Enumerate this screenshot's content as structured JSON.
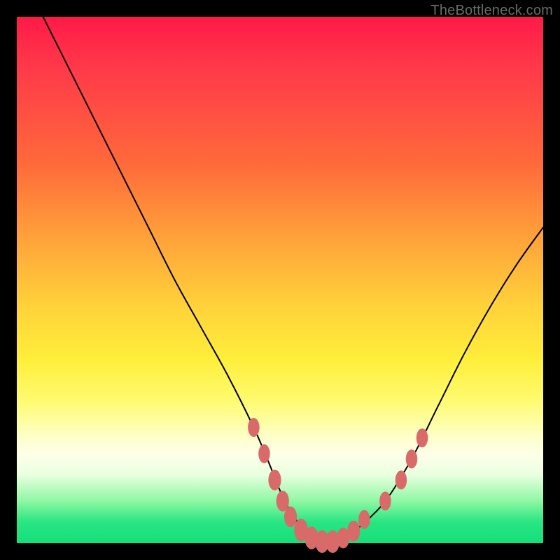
{
  "watermark": "TheBottleneck.com",
  "chart_data": {
    "type": "line",
    "title": "",
    "xlabel": "",
    "ylabel": "",
    "xlim": [
      0,
      100
    ],
    "ylim": [
      0,
      100
    ],
    "series": [
      {
        "name": "curve",
        "x": [
          5,
          10,
          15,
          20,
          25,
          30,
          35,
          40,
          45,
          48,
          50,
          52,
          55,
          58,
          60,
          62,
          65,
          70,
          75,
          80,
          85,
          90,
          95,
          100
        ],
        "values": [
          100,
          90,
          80,
          70,
          60,
          50,
          41,
          32,
          22,
          15,
          10,
          6,
          2,
          0,
          0,
          1,
          3,
          8,
          16,
          26,
          36,
          45,
          53,
          60
        ]
      }
    ],
    "markers": {
      "name": "beads",
      "color": "#d96a6a",
      "points": [
        {
          "x": 45,
          "y": 22,
          "r": 2.0
        },
        {
          "x": 47,
          "y": 17,
          "r": 2.0
        },
        {
          "x": 49,
          "y": 12,
          "r": 2.2
        },
        {
          "x": 50.5,
          "y": 8,
          "r": 2.2
        },
        {
          "x": 52,
          "y": 5,
          "r": 2.2
        },
        {
          "x": 54,
          "y": 2.5,
          "r": 2.4
        },
        {
          "x": 56,
          "y": 1,
          "r": 2.4
        },
        {
          "x": 58,
          "y": 0.3,
          "r": 2.4
        },
        {
          "x": 60,
          "y": 0.3,
          "r": 2.4
        },
        {
          "x": 62,
          "y": 1,
          "r": 2.2
        },
        {
          "x": 64,
          "y": 2.3,
          "r": 2.2
        },
        {
          "x": 66,
          "y": 4.5,
          "r": 2.0
        },
        {
          "x": 70,
          "y": 8,
          "r": 2.0
        },
        {
          "x": 73,
          "y": 12,
          "r": 2.0
        },
        {
          "x": 75,
          "y": 16,
          "r": 2.0
        },
        {
          "x": 77,
          "y": 20,
          "r": 2.0
        }
      ]
    }
  }
}
